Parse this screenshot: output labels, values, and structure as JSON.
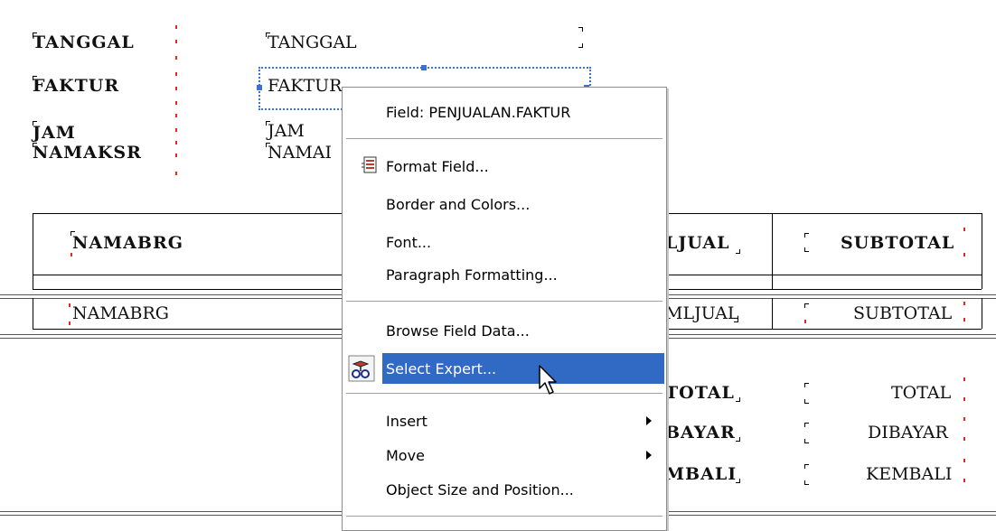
{
  "header_labels": [
    "TANGGAL",
    "FAKTUR",
    "JAM",
    "NAMAKSR"
  ],
  "header_fields": [
    "TANGGAL",
    "FAKTUR",
    "JAM",
    "NAMAI"
  ],
  "table_headers": {
    "namabrg": "NAMABRG",
    "jmljual": "LJUAL",
    "subtotal": "SUBTOTAL"
  },
  "detail_row": {
    "namabrg": "NAMABRG",
    "jmljual": "MLJUAL",
    "subtotal": "SUBTOTAL"
  },
  "footer_labels": [
    "TOTAL",
    "BAYAR",
    "MBALI"
  ],
  "footer_fields": [
    "TOTAL",
    "DIBAYAR",
    "KEMBALI"
  ],
  "context_menu": {
    "title": "Field: PENJUALAN.FAKTUR",
    "items": [
      {
        "label": "Format Field...",
        "icon": "format-field-icon"
      },
      {
        "label": "Border and Colors..."
      },
      {
        "label": "Font..."
      },
      {
        "label": "Paragraph Formatting..."
      },
      {
        "label": "Browse Field Data..."
      },
      {
        "label": "Select Expert...",
        "icon": "select-expert-icon",
        "highlighted": true
      },
      {
        "label": "Insert",
        "submenu": true
      },
      {
        "label": "Move",
        "submenu": true
      },
      {
        "label": "Object Size and Position..."
      }
    ]
  },
  "colors": {
    "highlight": "#316ac5",
    "marker_red": "#e8261d",
    "selection_blue": "#3d6fd6"
  }
}
